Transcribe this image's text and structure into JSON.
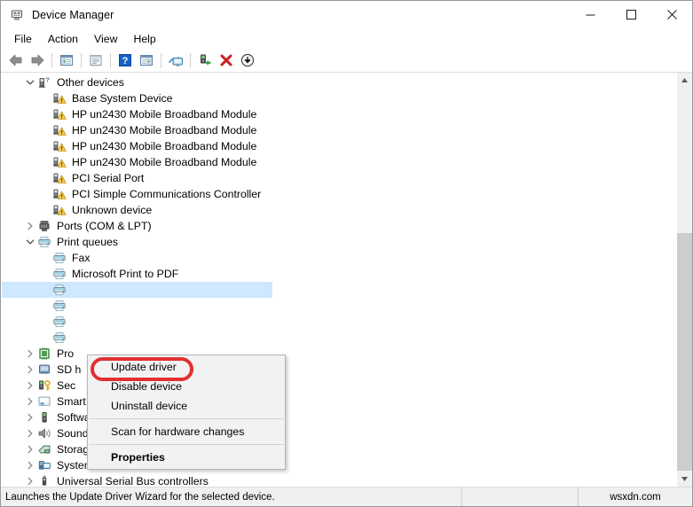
{
  "window": {
    "title": "Device Manager",
    "icon": "device-manager-icon",
    "controls": {
      "minimize": "—",
      "maximize": "□",
      "close": "✕"
    }
  },
  "menubar": {
    "items": [
      {
        "label": "File",
        "name": "menu-file"
      },
      {
        "label": "Action",
        "name": "menu-action"
      },
      {
        "label": "View",
        "name": "menu-view"
      },
      {
        "label": "Help",
        "name": "menu-help"
      }
    ]
  },
  "toolbar": {
    "buttons": [
      {
        "name": "back-button",
        "icon": "back-arrow-icon"
      },
      {
        "name": "forward-button",
        "icon": "forward-arrow-icon"
      },
      {
        "name": "separator-1",
        "icon": "separator"
      },
      {
        "name": "show-hide-console-tree-button",
        "icon": "console-tree-icon"
      },
      {
        "name": "separator-2",
        "icon": "separator"
      },
      {
        "name": "properties-button",
        "icon": "properties-window-icon"
      },
      {
        "name": "separator-3",
        "icon": "separator"
      },
      {
        "name": "help-button",
        "icon": "question-mark-icon"
      },
      {
        "name": "show-hide-action-pane-button",
        "icon": "action-pane-icon"
      },
      {
        "name": "separator-4",
        "icon": "separator"
      },
      {
        "name": "scan-for-hardware-changes-button",
        "icon": "monitor-scan-icon"
      },
      {
        "name": "separator-5",
        "icon": "separator"
      },
      {
        "name": "update-driver-button",
        "icon": "update-driver-icon"
      },
      {
        "name": "uninstall-device-button",
        "icon": "red-x-icon"
      },
      {
        "name": "disable-device-button",
        "icon": "down-arrow-circle-icon"
      }
    ]
  },
  "tree": {
    "rows": [
      {
        "label": "Other devices",
        "level": 0,
        "twisty": "expanded",
        "icon": "unknown-device-icon",
        "name": "tree-node-other-devices"
      },
      {
        "label": "Base System Device",
        "level": 1,
        "twisty": "none",
        "icon": "warning-device-icon",
        "name": "tree-item-base-system-device"
      },
      {
        "label": "HP un2430 Mobile Broadband Module",
        "level": 1,
        "twisty": "none",
        "icon": "warning-device-icon",
        "name": "tree-item-hp-un2430-1"
      },
      {
        "label": "HP un2430 Mobile Broadband Module",
        "level": 1,
        "twisty": "none",
        "icon": "warning-device-icon",
        "name": "tree-item-hp-un2430-2"
      },
      {
        "label": "HP un2430 Mobile Broadband Module",
        "level": 1,
        "twisty": "none",
        "icon": "warning-device-icon",
        "name": "tree-item-hp-un2430-3"
      },
      {
        "label": "HP un2430 Mobile Broadband Module",
        "level": 1,
        "twisty": "none",
        "icon": "warning-device-icon",
        "name": "tree-item-hp-un2430-4"
      },
      {
        "label": "PCI Serial Port",
        "level": 1,
        "twisty": "none",
        "icon": "warning-device-icon",
        "name": "tree-item-pci-serial-port"
      },
      {
        "label": "PCI Simple Communications Controller",
        "level": 1,
        "twisty": "none",
        "icon": "warning-device-icon",
        "name": "tree-item-pci-simple-communications-controller"
      },
      {
        "label": "Unknown device",
        "level": 1,
        "twisty": "none",
        "icon": "warning-device-icon",
        "name": "tree-item-unknown-device"
      },
      {
        "label": "Ports (COM & LPT)",
        "level": 0,
        "twisty": "collapsed",
        "icon": "ports-icon",
        "name": "tree-node-ports"
      },
      {
        "label": "Print queues",
        "level": 0,
        "twisty": "expanded",
        "icon": "printer-icon",
        "name": "tree-node-print-queues"
      },
      {
        "label": "Fax",
        "level": 1,
        "twisty": "none",
        "icon": "printer-icon",
        "name": "tree-item-fax"
      },
      {
        "label": "Microsoft Print to PDF",
        "level": 1,
        "twisty": "none",
        "icon": "printer-icon",
        "name": "tree-item-microsoft-print-to-pdf"
      },
      {
        "label": "",
        "level": 1,
        "twisty": "none",
        "icon": "printer-icon",
        "selected": true,
        "name": "tree-item-selected-printer"
      },
      {
        "label": "",
        "level": 1,
        "twisty": "none",
        "icon": "printer-icon",
        "name": "tree-item-printer-2"
      },
      {
        "label": "",
        "level": 1,
        "twisty": "none",
        "icon": "printer-icon",
        "name": "tree-item-printer-3"
      },
      {
        "label": "",
        "level": 1,
        "twisty": "none",
        "icon": "printer-icon",
        "name": "tree-item-printer-4"
      },
      {
        "label": "Pro",
        "level": 0,
        "twisty": "collapsed",
        "icon": "processor-icon",
        "name": "tree-node-processors"
      },
      {
        "label": "SD h",
        "level": 0,
        "twisty": "collapsed",
        "icon": "sd-host-icon",
        "name": "tree-node-sd-host-adapters"
      },
      {
        "label": "Sec",
        "level": 0,
        "twisty": "collapsed",
        "icon": "security-device-icon",
        "name": "tree-node-security-devices"
      },
      {
        "label": "Smart card readers",
        "level": 0,
        "twisty": "collapsed",
        "icon": "smart-card-reader-icon",
        "name": "tree-node-smart-card-readers"
      },
      {
        "label": "Software devices",
        "level": 0,
        "twisty": "collapsed",
        "icon": "software-device-icon",
        "name": "tree-node-software-devices"
      },
      {
        "label": "Sound, video and game controllers",
        "level": 0,
        "twisty": "collapsed",
        "icon": "speaker-icon",
        "name": "tree-node-sound-video-game-controllers"
      },
      {
        "label": "Storage controllers",
        "level": 0,
        "twisty": "collapsed",
        "icon": "storage-controller-icon",
        "name": "tree-node-storage-controllers"
      },
      {
        "label": "System devices",
        "level": 0,
        "twisty": "collapsed",
        "icon": "system-device-icon",
        "name": "tree-node-system-devices"
      },
      {
        "label": "Universal Serial Bus controllers",
        "level": 0,
        "twisty": "collapsed",
        "icon": "usb-icon",
        "name": "tree-node-usb-controllers"
      }
    ]
  },
  "context_menu": {
    "items": [
      {
        "label": "Update driver",
        "type": "item",
        "bold": false,
        "highlighted": true,
        "name": "context-menu-update-driver"
      },
      {
        "label": "Disable device",
        "type": "item",
        "bold": false,
        "name": "context-menu-disable-device"
      },
      {
        "label": "Uninstall device",
        "type": "item",
        "bold": false,
        "name": "context-menu-uninstall-device"
      },
      {
        "label": "",
        "type": "separator",
        "name": "context-menu-separator-1"
      },
      {
        "label": "Scan for hardware changes",
        "type": "item",
        "bold": false,
        "name": "context-menu-scan-for-hardware-changes"
      },
      {
        "label": "",
        "type": "separator",
        "name": "context-menu-separator-2"
      },
      {
        "label": "Properties",
        "type": "item",
        "bold": true,
        "name": "context-menu-properties"
      }
    ],
    "highlight_color": "#e03131"
  },
  "statusbar": {
    "message": "Launches the Update Driver Wizard for the selected device.",
    "middle": "",
    "watermark": "wsxdn.com"
  },
  "scrollbar": {
    "up_arrow": "▲",
    "down_arrow": "▼"
  }
}
